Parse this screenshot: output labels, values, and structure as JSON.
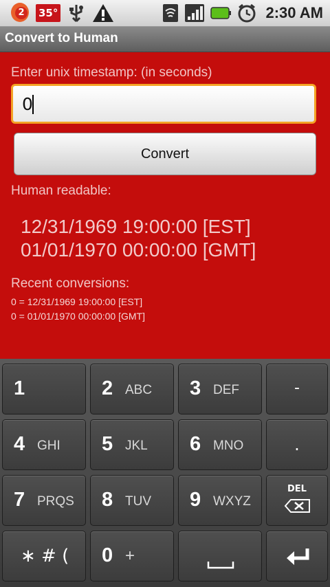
{
  "status_bar": {
    "notification_count": "2",
    "temperature": "35°",
    "time": "2:30 AM",
    "icons": [
      "notification-icon",
      "weather-icon",
      "usb-icon",
      "warning-icon",
      "wifi-icon",
      "signal-icon",
      "battery-icon",
      "alarm-icon"
    ]
  },
  "title_bar": {
    "title": "Convert to Human"
  },
  "form": {
    "prompt": "Enter unix timestamp: (in seconds)",
    "input_value": "0",
    "convert_label": "Convert"
  },
  "result": {
    "heading": "Human readable:",
    "lines": [
      "12/31/1969 19:00:00 [EST]",
      "01/01/1970 00:00:00 [GMT]"
    ]
  },
  "recent": {
    "heading": "Recent conversions:",
    "items": [
      "0 = 12/31/1969 19:00:00 [EST]",
      "0 = 01/01/1970 00:00:00 [GMT]"
    ]
  },
  "keypad": {
    "rows": [
      [
        {
          "digit": "1",
          "letters": ""
        },
        {
          "digit": "2",
          "letters": "ABC"
        },
        {
          "digit": "3",
          "letters": "DEF"
        },
        {
          "digit": "",
          "letters": "-"
        }
      ],
      [
        {
          "digit": "4",
          "letters": "GHI"
        },
        {
          "digit": "5",
          "letters": "JKL"
        },
        {
          "digit": "6",
          "letters": "MNO"
        },
        {
          "digit": "",
          "letters": "."
        }
      ],
      [
        {
          "digit": "7",
          "letters": "PRQS"
        },
        {
          "digit": "8",
          "letters": "TUV"
        },
        {
          "digit": "9",
          "letters": "WXYZ"
        },
        {
          "digit": "",
          "letters": "DEL"
        }
      ],
      [
        {
          "digit": "",
          "letters": "* # ("
        },
        {
          "digit": "0",
          "letters": "+"
        },
        {
          "digit": "",
          "letters": "space"
        },
        {
          "digit": "",
          "letters": "enter"
        }
      ]
    ]
  },
  "colors": {
    "background_red": "#c40d0c",
    "focus_orange": "#f4a325"
  }
}
